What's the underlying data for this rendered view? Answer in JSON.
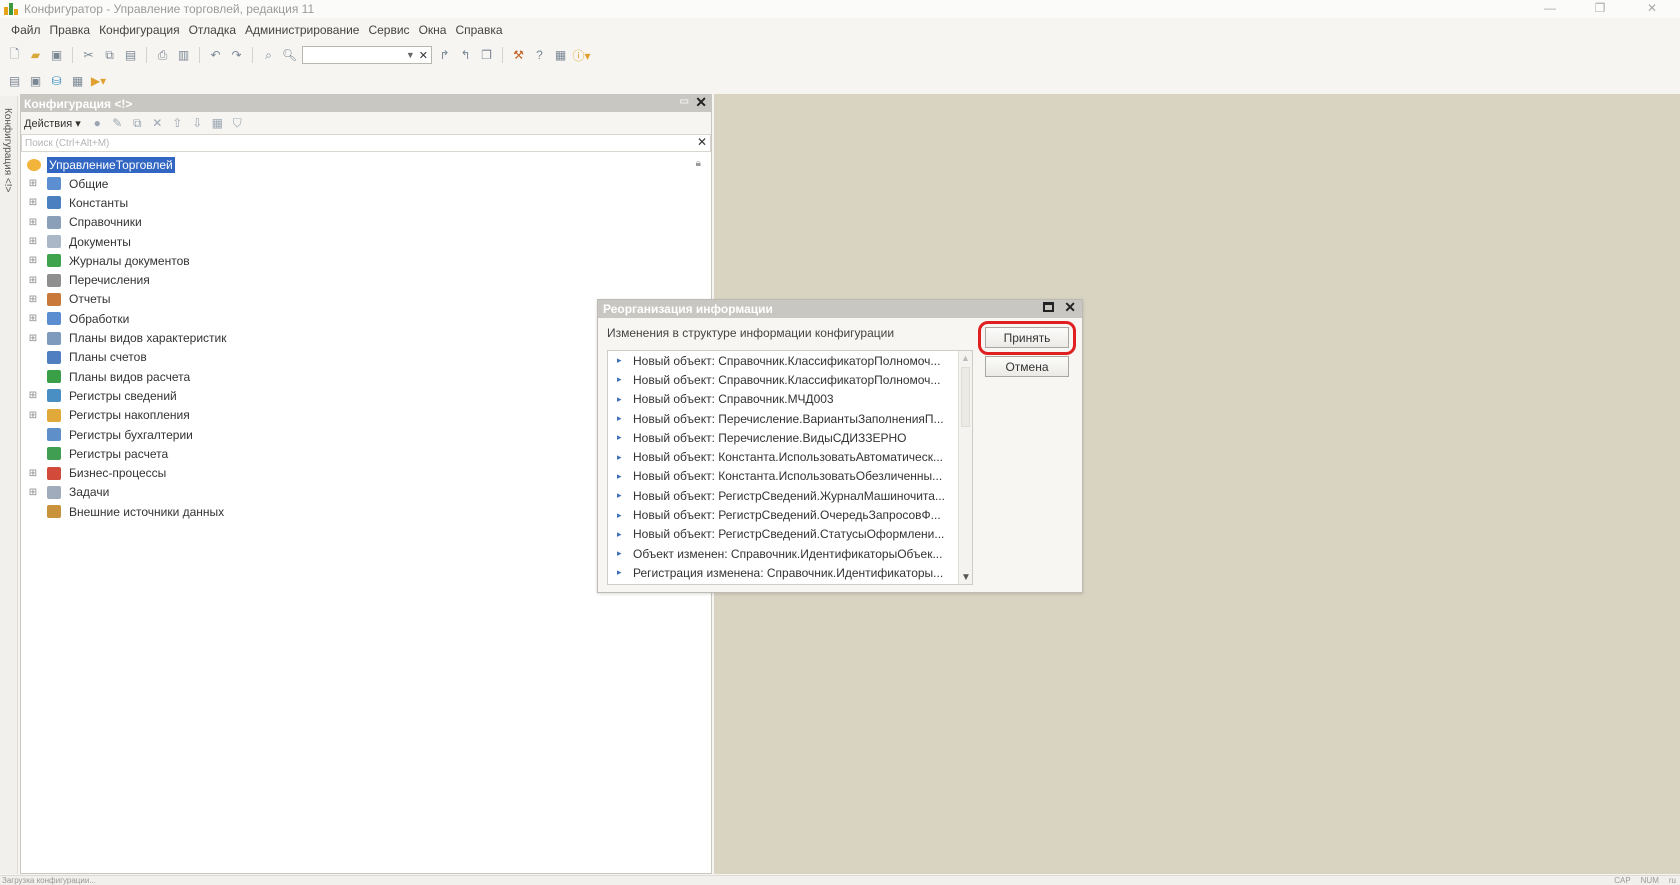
{
  "window": {
    "title": "Конфигуратор - Управление торговлей, редакция 11",
    "controls": [
      "—",
      "❐",
      "✕"
    ]
  },
  "menubar": [
    "Файл",
    "Правка",
    "Конфигурация",
    "Отладка",
    "Администрирование",
    "Сервис",
    "Окна",
    "Справка"
  ],
  "toolbar1": {
    "icons": [
      "new-document-icon",
      "open-folder-icon",
      "save-icon",
      "cut-icon",
      "copy-icon",
      "paste-icon",
      "print-icon",
      "print-preview-icon",
      "undo-icon",
      "redo-icon",
      "find-icon",
      "search-icon",
      "search-combo",
      "find-next-icon",
      "find-previous-icon",
      "window-icon",
      "debug-icon",
      "help-icon",
      "document-icon",
      "info-icon"
    ]
  },
  "toolbar2": {
    "icons": [
      "config-tree-icon",
      "properties-icon",
      "database-icon",
      "table-icon",
      "run-icon"
    ]
  },
  "left_strip": {
    "label": "Конфигурация <!>"
  },
  "config_panel": {
    "title": "Конфигурация <!>",
    "actions_label": "Действия",
    "search_placeholder": "Поиск (Ctrl+Alt+M)",
    "root": "УправлениеТорговлей",
    "items": [
      {
        "label": "Общие",
        "icon": "common-icon",
        "expandable": true,
        "color": "#5b8fd1"
      },
      {
        "label": "Константы",
        "icon": "constants-icon",
        "expandable": true,
        "color": "#4a7fc0"
      },
      {
        "label": "Справочники",
        "icon": "catalogs-icon",
        "expandable": true,
        "color": "#8aa0b8"
      },
      {
        "label": "Документы",
        "icon": "documents-icon",
        "expandable": true,
        "color": "#a9b7c6"
      },
      {
        "label": "Журналы документов",
        "icon": "journals-icon",
        "expandable": true,
        "color": "#3fa34d"
      },
      {
        "label": "Перечисления",
        "icon": "enumerations-icon",
        "expandable": true,
        "color": "#8f8f8f"
      },
      {
        "label": "Отчеты",
        "icon": "reports-icon",
        "expandable": true,
        "color": "#c97a3a"
      },
      {
        "label": "Обработки",
        "icon": "processing-icon",
        "expandable": true,
        "color": "#5a8ed0"
      },
      {
        "label": "Планы видов характеристик",
        "icon": "characteristics-icon",
        "expandable": true,
        "color": "#7e9bbd"
      },
      {
        "label": "Планы счетов",
        "icon": "chart-of-accounts-icon",
        "expandable": false,
        "color": "#4f7fc0"
      },
      {
        "label": "Планы видов расчета",
        "icon": "calculation-types-icon",
        "expandable": false,
        "color": "#3aa048"
      },
      {
        "label": "Регистры сведений",
        "icon": "info-registers-icon",
        "expandable": true,
        "color": "#4a8fc4"
      },
      {
        "label": "Регистры накопления",
        "icon": "accumulation-registers-icon",
        "expandable": true,
        "color": "#e0a93a"
      },
      {
        "label": "Регистры бухгалтерии",
        "icon": "accounting-registers-icon",
        "expandable": false,
        "color": "#5e8fc8"
      },
      {
        "label": "Регистры расчета",
        "icon": "calculation-registers-icon",
        "expandable": false,
        "color": "#3f9e52"
      },
      {
        "label": "Бизнес-процессы",
        "icon": "business-processes-icon",
        "expandable": true,
        "color": "#d24a3a"
      },
      {
        "label": "Задачи",
        "icon": "tasks-icon",
        "expandable": true,
        "color": "#a0acbb"
      },
      {
        "label": "Внешние источники данных",
        "icon": "external-sources-icon",
        "expandable": false,
        "color": "#c9933c"
      }
    ]
  },
  "dialog": {
    "title": "Реорганизация информации",
    "caption": "Изменения в структуре информации конфигурации",
    "accept_label": "Принять",
    "cancel_label": "Отмена",
    "rows": [
      "Новый объект: Справочник.КлассификаторПолномоч...",
      "Новый объект: Справочник.КлассификаторПолномоч...",
      "Новый объект: Справочник.МЧД003",
      "Новый объект: Перечисление.ВариантыЗаполненияП...",
      "Новый объект: Перечисление.ВидыСДИЗЗЕРНО",
      "Новый объект: Константа.ИспользоватьАвтоматическ...",
      "Новый объект: Константа.ИспользоватьОбезличенны...",
      "Новый объект: РегистрСведений.ЖурналМашиночита...",
      "Новый объект: РегистрСведений.ОчередьЗапросовФ...",
      "Новый объект: РегистрСведений.СтатусыОформлени...",
      "Объект изменен: Справочник.ИдентификаторыОбъек...",
      "Регистрация изменена: Справочник.Идентификаторы..."
    ]
  },
  "statusbar": {
    "left": "Загрузка конфигурации...",
    "right": [
      "CAP",
      "NUM",
      "ru"
    ]
  },
  "colors": {
    "desktop": "#d9d3c2",
    "header": "#c9c7c1",
    "selection": "#3166c2",
    "highlight": "#e02020"
  }
}
